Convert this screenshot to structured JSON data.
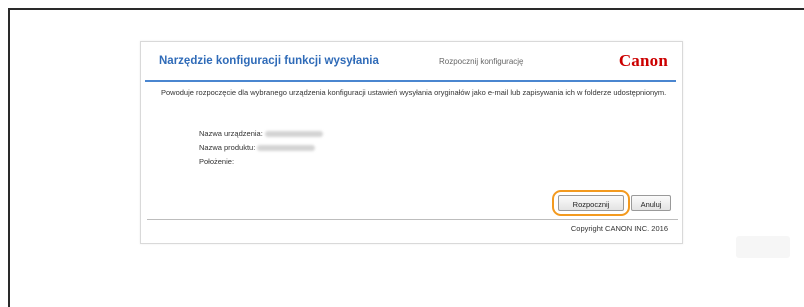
{
  "dialog": {
    "title": "Narzędzie konfiguracji funkcji wysyłania",
    "subtitle": "Rozpocznij konfigurację",
    "logo": "Canon",
    "description": "Powoduje rozpoczęcie dla wybranego urządzenia konfiguracji ustawień wysyłania oryginałów jako e-mail lub zapisywania ich w folderze udostępnionym.",
    "info": {
      "device_name_label": "Nazwa urządzenia:",
      "product_name_label": "Nazwa produktu:",
      "location_label": "Położenie:"
    },
    "buttons": {
      "start": "Rozpocznij",
      "cancel": "Anuluj"
    },
    "copyright": "Copyright CANON INC. 2016"
  },
  "colors": {
    "title": "#2f6bb8",
    "header_rule": "#4a86d0",
    "logo": "#cc0000",
    "highlight": "#f39a1f"
  }
}
